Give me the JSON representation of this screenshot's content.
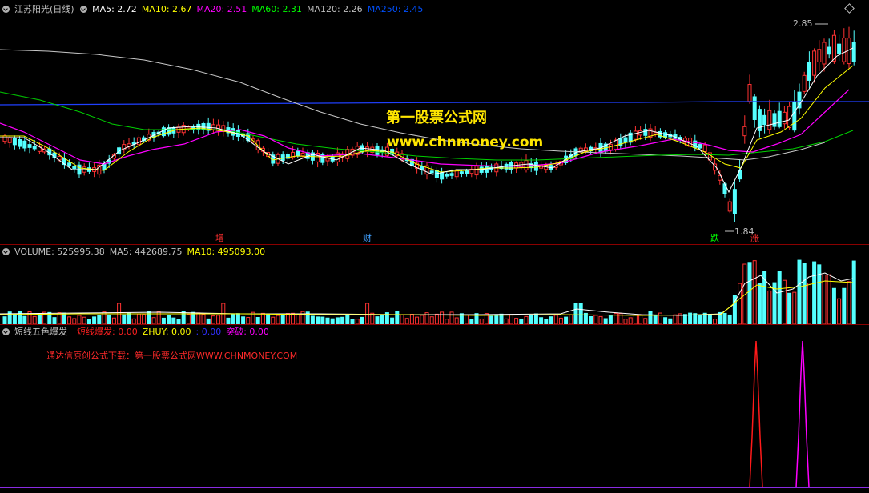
{
  "main_panel": {
    "stock_name": "江苏阳光(日线)",
    "indicators": [
      {
        "label": "MA5: 2.72",
        "color": "#ffffff"
      },
      {
        "label": "MA10: 2.67",
        "color": "#ffff00"
      },
      {
        "label": "MA20: 2.51",
        "color": "#ff00ff"
      },
      {
        "label": "MA60: 2.31",
        "color": "#00ff00"
      },
      {
        "label": "MA120: 2.26",
        "color": "#c0c0c0"
      },
      {
        "label": "MA250: 2.45",
        "color": "#0050ff"
      }
    ],
    "high_label": "2.85",
    "low_label": "1.84",
    "watermark_title": "第一股票公式网",
    "watermark_url": "www.chnmoney.com",
    "events": [
      {
        "label": "增",
        "color": "#ff3030"
      },
      {
        "label": "财",
        "color": "#40a0ff"
      },
      {
        "label": "跌",
        "color": "#00ff00"
      },
      {
        "label": "涨",
        "color": "#ff3030"
      }
    ]
  },
  "volume_panel": {
    "items": [
      {
        "label": "VOLUME: 525995.38",
        "color": "#c0c0c0"
      },
      {
        "label": "MA5: 442689.75",
        "color": "#c0c0c0"
      },
      {
        "label": "MA10: 495093.00",
        "color": "#ffff00"
      }
    ]
  },
  "indicator_panel": {
    "name": "短线五色爆发",
    "items": [
      {
        "label": "短线爆发: 0.00",
        "color": "#ff2020"
      },
      {
        "label": "ZHUY: 0.00",
        "color": "#ffff00"
      },
      {
        "label": ": 0.00",
        "color": "#3030ff"
      },
      {
        "label": "突破: 0.00",
        "color": "#ff00ff"
      }
    ],
    "download_note": "通达信原创公式下载：第一股票公式网WWW.CHNMONEY.COM"
  },
  "colors": {
    "up": "#ff3232",
    "down": "#54ffff",
    "separator": "#8a0000",
    "background": "#000000"
  }
}
